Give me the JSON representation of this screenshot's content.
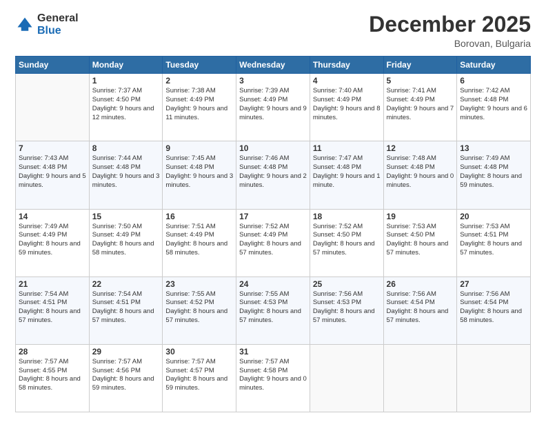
{
  "logo": {
    "general": "General",
    "blue": "Blue"
  },
  "header": {
    "month_year": "December 2025",
    "location": "Borovan, Bulgaria"
  },
  "days_of_week": [
    "Sunday",
    "Monday",
    "Tuesday",
    "Wednesday",
    "Thursday",
    "Friday",
    "Saturday"
  ],
  "weeks": [
    [
      {
        "day": "",
        "sunrise": "",
        "sunset": "",
        "daylight": ""
      },
      {
        "day": "1",
        "sunrise": "Sunrise: 7:37 AM",
        "sunset": "Sunset: 4:50 PM",
        "daylight": "Daylight: 9 hours and 12 minutes."
      },
      {
        "day": "2",
        "sunrise": "Sunrise: 7:38 AM",
        "sunset": "Sunset: 4:49 PM",
        "daylight": "Daylight: 9 hours and 11 minutes."
      },
      {
        "day": "3",
        "sunrise": "Sunrise: 7:39 AM",
        "sunset": "Sunset: 4:49 PM",
        "daylight": "Daylight: 9 hours and 9 minutes."
      },
      {
        "day": "4",
        "sunrise": "Sunrise: 7:40 AM",
        "sunset": "Sunset: 4:49 PM",
        "daylight": "Daylight: 9 hours and 8 minutes."
      },
      {
        "day": "5",
        "sunrise": "Sunrise: 7:41 AM",
        "sunset": "Sunset: 4:49 PM",
        "daylight": "Daylight: 9 hours and 7 minutes."
      },
      {
        "day": "6",
        "sunrise": "Sunrise: 7:42 AM",
        "sunset": "Sunset: 4:48 PM",
        "daylight": "Daylight: 9 hours and 6 minutes."
      }
    ],
    [
      {
        "day": "7",
        "sunrise": "Sunrise: 7:43 AM",
        "sunset": "Sunset: 4:48 PM",
        "daylight": "Daylight: 9 hours and 5 minutes."
      },
      {
        "day": "8",
        "sunrise": "Sunrise: 7:44 AM",
        "sunset": "Sunset: 4:48 PM",
        "daylight": "Daylight: 9 hours and 3 minutes."
      },
      {
        "day": "9",
        "sunrise": "Sunrise: 7:45 AM",
        "sunset": "Sunset: 4:48 PM",
        "daylight": "Daylight: 9 hours and 3 minutes."
      },
      {
        "day": "10",
        "sunrise": "Sunrise: 7:46 AM",
        "sunset": "Sunset: 4:48 PM",
        "daylight": "Daylight: 9 hours and 2 minutes."
      },
      {
        "day": "11",
        "sunrise": "Sunrise: 7:47 AM",
        "sunset": "Sunset: 4:48 PM",
        "daylight": "Daylight: 9 hours and 1 minute."
      },
      {
        "day": "12",
        "sunrise": "Sunrise: 7:48 AM",
        "sunset": "Sunset: 4:48 PM",
        "daylight": "Daylight: 9 hours and 0 minutes."
      },
      {
        "day": "13",
        "sunrise": "Sunrise: 7:49 AM",
        "sunset": "Sunset: 4:48 PM",
        "daylight": "Daylight: 8 hours and 59 minutes."
      }
    ],
    [
      {
        "day": "14",
        "sunrise": "Sunrise: 7:49 AM",
        "sunset": "Sunset: 4:49 PM",
        "daylight": "Daylight: 8 hours and 59 minutes."
      },
      {
        "day": "15",
        "sunrise": "Sunrise: 7:50 AM",
        "sunset": "Sunset: 4:49 PM",
        "daylight": "Daylight: 8 hours and 58 minutes."
      },
      {
        "day": "16",
        "sunrise": "Sunrise: 7:51 AM",
        "sunset": "Sunset: 4:49 PM",
        "daylight": "Daylight: 8 hours and 58 minutes."
      },
      {
        "day": "17",
        "sunrise": "Sunrise: 7:52 AM",
        "sunset": "Sunset: 4:49 PM",
        "daylight": "Daylight: 8 hours and 57 minutes."
      },
      {
        "day": "18",
        "sunrise": "Sunrise: 7:52 AM",
        "sunset": "Sunset: 4:50 PM",
        "daylight": "Daylight: 8 hours and 57 minutes."
      },
      {
        "day": "19",
        "sunrise": "Sunrise: 7:53 AM",
        "sunset": "Sunset: 4:50 PM",
        "daylight": "Daylight: 8 hours and 57 minutes."
      },
      {
        "day": "20",
        "sunrise": "Sunrise: 7:53 AM",
        "sunset": "Sunset: 4:51 PM",
        "daylight": "Daylight: 8 hours and 57 minutes."
      }
    ],
    [
      {
        "day": "21",
        "sunrise": "Sunrise: 7:54 AM",
        "sunset": "Sunset: 4:51 PM",
        "daylight": "Daylight: 8 hours and 57 minutes."
      },
      {
        "day": "22",
        "sunrise": "Sunrise: 7:54 AM",
        "sunset": "Sunset: 4:51 PM",
        "daylight": "Daylight: 8 hours and 57 minutes."
      },
      {
        "day": "23",
        "sunrise": "Sunrise: 7:55 AM",
        "sunset": "Sunset: 4:52 PM",
        "daylight": "Daylight: 8 hours and 57 minutes."
      },
      {
        "day": "24",
        "sunrise": "Sunrise: 7:55 AM",
        "sunset": "Sunset: 4:53 PM",
        "daylight": "Daylight: 8 hours and 57 minutes."
      },
      {
        "day": "25",
        "sunrise": "Sunrise: 7:56 AM",
        "sunset": "Sunset: 4:53 PM",
        "daylight": "Daylight: 8 hours and 57 minutes."
      },
      {
        "day": "26",
        "sunrise": "Sunrise: 7:56 AM",
        "sunset": "Sunset: 4:54 PM",
        "daylight": "Daylight: 8 hours and 57 minutes."
      },
      {
        "day": "27",
        "sunrise": "Sunrise: 7:56 AM",
        "sunset": "Sunset: 4:54 PM",
        "daylight": "Daylight: 8 hours and 58 minutes."
      }
    ],
    [
      {
        "day": "28",
        "sunrise": "Sunrise: 7:57 AM",
        "sunset": "Sunset: 4:55 PM",
        "daylight": "Daylight: 8 hours and 58 minutes."
      },
      {
        "day": "29",
        "sunrise": "Sunrise: 7:57 AM",
        "sunset": "Sunset: 4:56 PM",
        "daylight": "Daylight: 8 hours and 59 minutes."
      },
      {
        "day": "30",
        "sunrise": "Sunrise: 7:57 AM",
        "sunset": "Sunset: 4:57 PM",
        "daylight": "Daylight: 8 hours and 59 minutes."
      },
      {
        "day": "31",
        "sunrise": "Sunrise: 7:57 AM",
        "sunset": "Sunset: 4:58 PM",
        "daylight": "Daylight: 9 hours and 0 minutes."
      },
      {
        "day": "",
        "sunrise": "",
        "sunset": "",
        "daylight": ""
      },
      {
        "day": "",
        "sunrise": "",
        "sunset": "",
        "daylight": ""
      },
      {
        "day": "",
        "sunrise": "",
        "sunset": "",
        "daylight": ""
      }
    ]
  ]
}
